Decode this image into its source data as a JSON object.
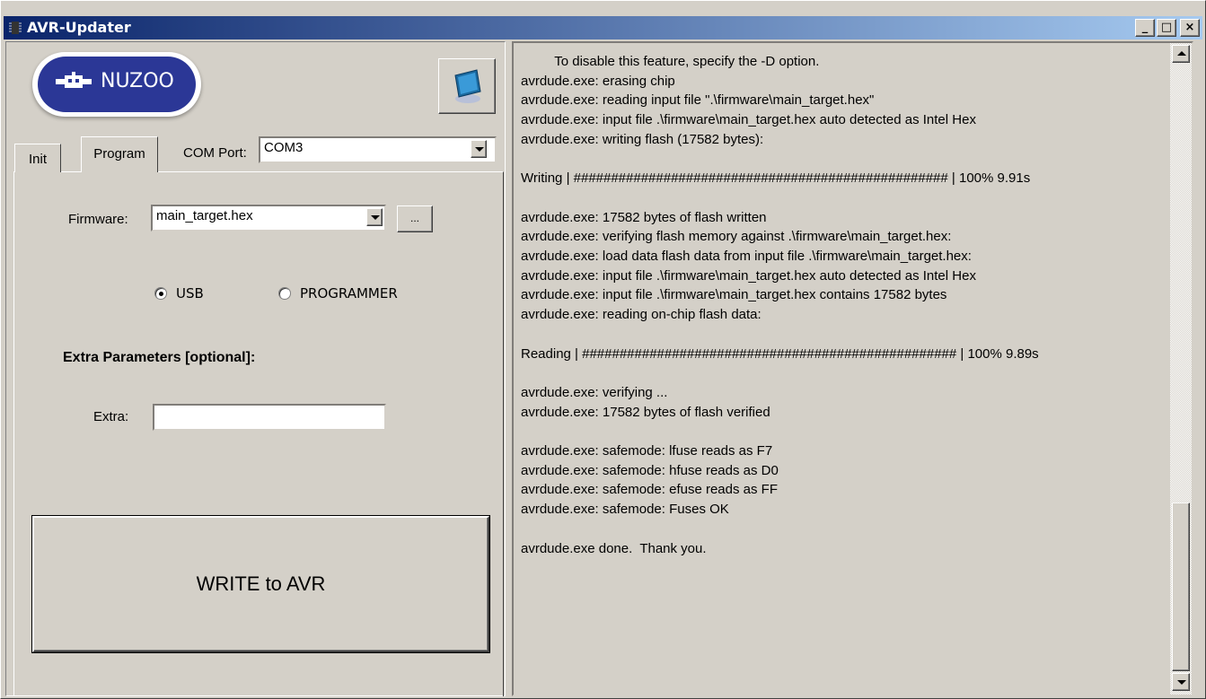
{
  "window": {
    "title": "AVR-Updater",
    "minimize": "_",
    "maximize": "□",
    "close": "×"
  },
  "logo": {
    "text": "NUZOO"
  },
  "tabs": {
    "init": "Init",
    "program": "Program"
  },
  "com_port": {
    "label": "COM Port:",
    "value": "COM3"
  },
  "firmware": {
    "label": "Firmware:",
    "value": "main_target.hex",
    "browse": "..."
  },
  "mode": {
    "usb": "USB",
    "programmer": "PROGRAMMER",
    "selected": "USB"
  },
  "extra": {
    "heading": "Extra Parameters [optional]:",
    "label": "Extra:",
    "value": ""
  },
  "write_button": "WRITE to AVR",
  "log": {
    "text": "         To disable this feature, specify the -D option.\navrdude.exe: erasing chip\navrdude.exe: reading input file \".\\firmware\\main_target.hex\"\navrdude.exe: input file .\\firmware\\main_target.hex auto detected as Intel Hex\navrdude.exe: writing flash (17582 bytes):\n\nWriting | ################################################## | 100% 9.91s\n\navrdude.exe: 17582 bytes of flash written\navrdude.exe: verifying flash memory against .\\firmware\\main_target.hex:\navrdude.exe: load data flash data from input file .\\firmware\\main_target.hex:\navrdude.exe: input file .\\firmware\\main_target.hex auto detected as Intel Hex\navrdude.exe: input file .\\firmware\\main_target.hex contains 17582 bytes\navrdude.exe: reading on-chip flash data:\n\nReading | ################################################## | 100% 9.89s\n\navrdude.exe: verifying ...\navrdude.exe: 17582 bytes of flash verified\n\navrdude.exe: safemode: lfuse reads as F7\navrdude.exe: safemode: hfuse reads as D0\navrdude.exe: safemode: efuse reads as FF\navrdude.exe: safemode: Fuses OK\n\navrdude.exe done.  Thank you."
  }
}
